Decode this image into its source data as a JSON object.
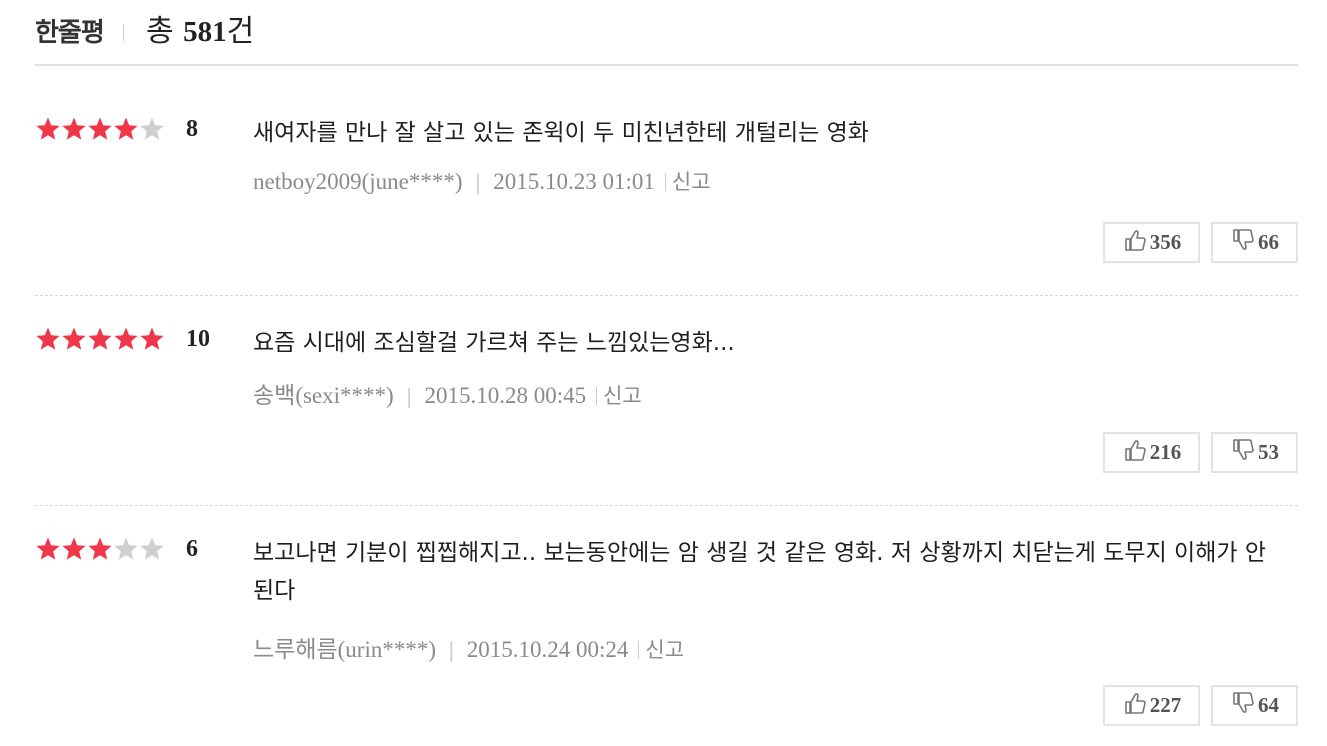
{
  "header": {
    "title": "한줄평",
    "total_prefix": "총 ",
    "total_count": "581",
    "total_suffix": "건"
  },
  "reviews": [
    {
      "rating_stars": 4,
      "score": "8",
      "text": "새여자를 만나 잘 살고 있는 존윅이 두 미친년한테 개털리는 영화",
      "author": "netboy2009(june****)",
      "date": "2015.10.23 01:01",
      "report_label": "신고",
      "likes": "356",
      "dislikes": "66"
    },
    {
      "rating_stars": 5,
      "score": "10",
      "text": "요즘 시대에 조심할걸 가르쳐 주는 느낌있는영화...",
      "author": "송백(sexi****)",
      "date": "2015.10.28 00:45",
      "report_label": "신고",
      "likes": "216",
      "dislikes": "53"
    },
    {
      "rating_stars": 3,
      "score": "6",
      "text": "보고나면 기분이 찝찝해지고.. 보는동안에는 암 생길 것 같은 영화. 저 상황까지 치닫는게 도무지 이해가 안된다",
      "author": "느루해름(urin****)",
      "date": "2015.10.24 00:24",
      "report_label": "신고",
      "likes": "227",
      "dislikes": "64"
    }
  ],
  "colors": {
    "star_on": "#f0374a",
    "star_off": "#cfcfcf"
  },
  "icons": {
    "like": "thumbs-up-icon",
    "dislike": "thumbs-down-icon",
    "star": "star-icon"
  }
}
